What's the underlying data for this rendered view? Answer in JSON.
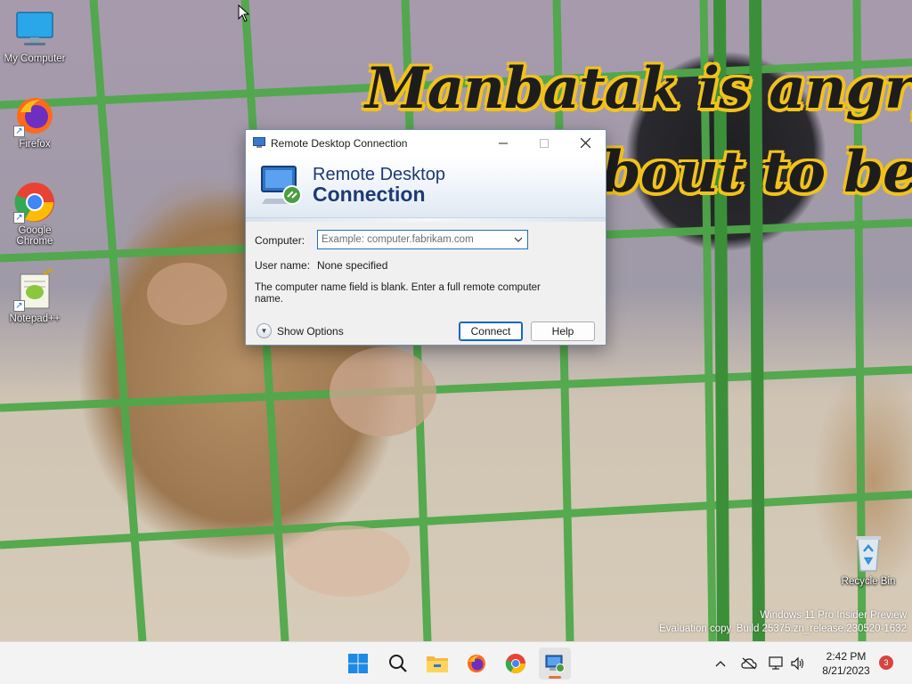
{
  "wallpaper": {
    "caption_line1": "Manbatak is angry th",
    "caption_line2": "bout to be pai",
    "watermark_line1": "Windows 11 Pro Insider Preview",
    "watermark_line2": "Evaluation copy. Build 25375.zn_release.230520-1632"
  },
  "desktop": {
    "icons": [
      {
        "label": "My Computer",
        "icon": "monitor-icon"
      },
      {
        "label": "Firefox",
        "icon": "firefox-icon"
      },
      {
        "label": "Google Chrome",
        "icon": "chrome-icon"
      },
      {
        "label": "Notepad++",
        "icon": "notepadpp-icon"
      },
      {
        "label": "Recycle Bin",
        "icon": "recycle-bin-icon"
      }
    ]
  },
  "dialog": {
    "window_title": "Remote Desktop Connection",
    "banner_line1": "Remote Desktop",
    "banner_line2": "Connection",
    "computer_label": "Computer:",
    "computer_value": "",
    "computer_placeholder": "Example: computer.fabrikam.com",
    "username_label": "User name:",
    "username_value": "None specified",
    "message": "The computer name field is blank. Enter a full remote computer name.",
    "show_options": "Show Options",
    "connect_label": "Connect",
    "help_label": "Help"
  },
  "taskbar": {
    "apps": [
      "start-icon",
      "search-icon",
      "file-explorer-icon",
      "firefox-icon",
      "chrome-icon",
      "remote-desktop-icon"
    ],
    "time": "2:42 PM",
    "date": "8/21/2023",
    "notification_count": "3"
  },
  "colors": {
    "accent": "#1566c6",
    "banner_text": "#1c3a75",
    "bar_green": "#4fa84a",
    "caption_outline": "#f1c21b"
  }
}
